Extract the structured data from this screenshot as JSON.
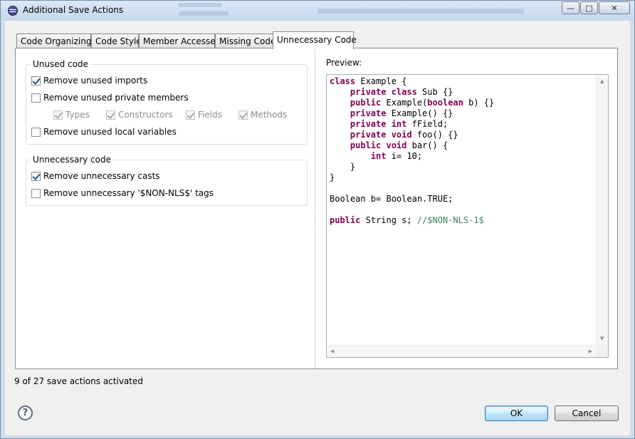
{
  "window": {
    "title": "Additional Save Actions",
    "minimize_glyph": "—",
    "maximize_glyph": "□",
    "close_glyph": "✕"
  },
  "tabs": [
    {
      "label": "Code Organizing",
      "active": false
    },
    {
      "label": "Code Style",
      "active": false
    },
    {
      "label": "Member Accesses",
      "active": false
    },
    {
      "label": "Missing Code",
      "active": false
    },
    {
      "label": "Unnecessary Code",
      "active": true
    }
  ],
  "unused_code": {
    "title": "Unused code",
    "remove_unused_imports": {
      "label": "Remove unused imports",
      "checked": true
    },
    "remove_unused_private_members": {
      "label": "Remove unused private members",
      "checked": false
    },
    "types": {
      "label": "Types",
      "checked": true,
      "enabled": false
    },
    "constructors": {
      "label": "Constructors",
      "checked": true,
      "enabled": false
    },
    "fields": {
      "label": "Fields",
      "checked": true,
      "enabled": false
    },
    "methods": {
      "label": "Methods",
      "checked": true,
      "enabled": false
    },
    "remove_unused_local_variables": {
      "label": "Remove unused local variables",
      "checked": false
    }
  },
  "unnecessary_code": {
    "title": "Unnecessary code",
    "remove_unnecessary_casts": {
      "label": "Remove unnecessary casts",
      "checked": true
    },
    "remove_unnecessary_nls_tags": {
      "label": "Remove unnecessary '$NON-NLS$' tags",
      "checked": false
    }
  },
  "preview": {
    "label": "Preview:",
    "code_lines": [
      [
        {
          "t": "class",
          "k": "kw"
        },
        {
          "t": " Example {"
        }
      ],
      [
        {
          "t": "    "
        },
        {
          "t": "private class",
          "k": "kw"
        },
        {
          "t": " Sub {}"
        }
      ],
      [
        {
          "t": "    "
        },
        {
          "t": "public",
          "k": "kw"
        },
        {
          "t": " Example("
        },
        {
          "t": "boolean",
          "k": "kw"
        },
        {
          "t": " b) {}"
        }
      ],
      [
        {
          "t": "    "
        },
        {
          "t": "private",
          "k": "kw"
        },
        {
          "t": " Example() {}"
        }
      ],
      [
        {
          "t": "    "
        },
        {
          "t": "private int",
          "k": "kw"
        },
        {
          "t": " fField;"
        }
      ],
      [
        {
          "t": "    "
        },
        {
          "t": "private void",
          "k": "kw"
        },
        {
          "t": " foo() {}"
        }
      ],
      [
        {
          "t": "    "
        },
        {
          "t": "public void",
          "k": "kw"
        },
        {
          "t": " bar() {"
        }
      ],
      [
        {
          "t": "        "
        },
        {
          "t": "int",
          "k": "kw"
        },
        {
          "t": " i= 10;"
        }
      ],
      [
        {
          "t": "    }"
        }
      ],
      [
        {
          "t": "}"
        }
      ],
      [
        {
          "t": ""
        }
      ],
      [
        {
          "t": "Boolean b= Boolean.TRUE;"
        }
      ],
      [
        {
          "t": ""
        }
      ],
      [
        {
          "t": "public",
          "k": "kw"
        },
        {
          "t": " String s; "
        },
        {
          "t": "//$NON-NLS-1$",
          "k": "cmt"
        }
      ]
    ]
  },
  "status": "9 of 27 save actions activated",
  "buttons": {
    "help": "?",
    "ok": "OK",
    "cancel": "Cancel"
  }
}
